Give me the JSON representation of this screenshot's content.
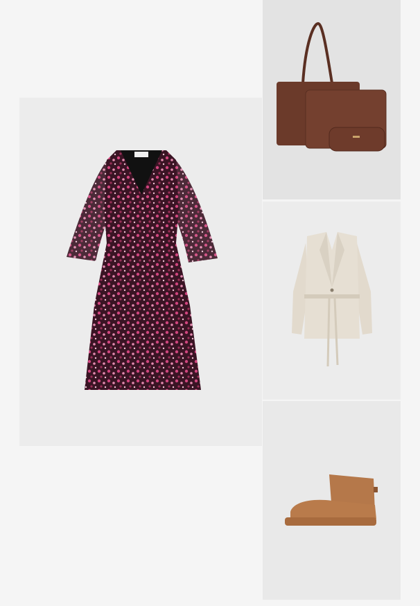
{
  "outfit": {
    "items": [
      {
        "kind": "dress",
        "image": "floral-wrap-dress-image"
      },
      {
        "kind": "bag",
        "image": "brown-leather-bag-set-image"
      },
      {
        "kind": "blazer",
        "image": "beige-belted-blazer-image"
      },
      {
        "kind": "boot",
        "image": "tan-suede-ankle-boot-image"
      }
    ]
  },
  "colors": {
    "page_background": "#f5f5f5",
    "dress_base": "#3a1424",
    "dress_print_pink": "#d0457e",
    "bag_brown": "#6b3a2a",
    "blazer_beige": "#e6dfd3",
    "boot_tan": "#b5784a"
  }
}
